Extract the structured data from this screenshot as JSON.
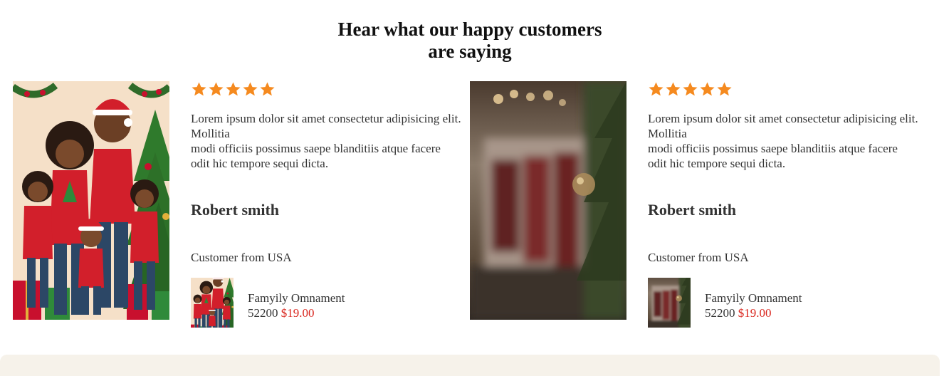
{
  "section": {
    "title_line1": "Hear what our happy customers",
    "title_line2": "are saying"
  },
  "colors": {
    "star": "#f58a1f",
    "sale_price": "#d9251d",
    "footer_band": "#f6f2ea"
  },
  "testimonials": [
    {
      "rating": 5,
      "review_line1": "Lorem ipsum dolor sit amet consectetur adipisicing elit. Mollitia",
      "review_line2": "modi officiis possimus saepe blanditiis atque facere odit hic tempore sequi dicta.",
      "name": "Robert smith",
      "location": "Customer from USA",
      "product_name": "Famyily Omnament",
      "old_price": "52200",
      "new_price": "$19.00",
      "image": "family-christmas-illustration"
    },
    {
      "rating": 5,
      "review_line1": "Lorem ipsum dolor sit amet consectetur adipisicing elit. Mollitia",
      "review_line2": "modi officiis possimus saepe blanditiis atque facere odit hic tempore sequi dicta.",
      "name": "Robert smith",
      "location": "Customer from USA",
      "product_name": "Famyily Omnament",
      "old_price": "52200",
      "new_price": "$19.00",
      "image": "blurred-stockings-photo"
    }
  ]
}
